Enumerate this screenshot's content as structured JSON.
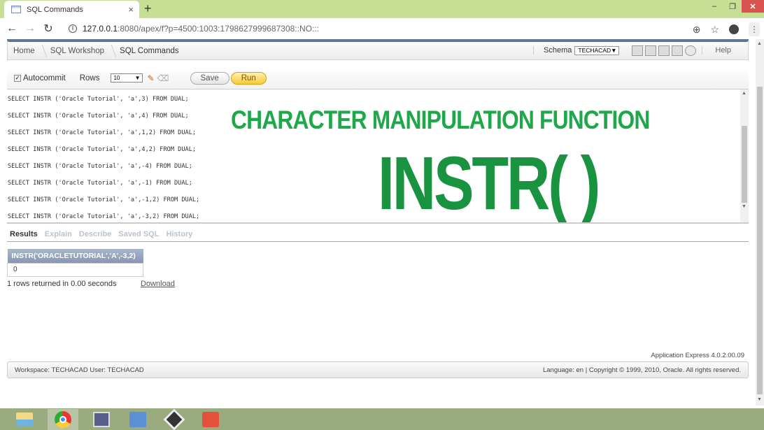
{
  "browser": {
    "tab_title": "SQL Commands",
    "new_tab_icon": "+",
    "close_tab_icon": "×",
    "url_host": "127.0.0.1",
    "url_rest": ":8080/apex/f?p=4500:1003:1798627999687308::NO:::",
    "window_controls": {
      "minimize": "–",
      "restore": "❐",
      "close": "✕"
    }
  },
  "breadcrumb": [
    "Home",
    "SQL Workshop",
    "SQL Commands"
  ],
  "schema": {
    "label": "Schema",
    "value": "TECHACAD"
  },
  "help_label": "Help",
  "toolbar": {
    "autocommit_label": "Autocommit",
    "autocommit_checked": true,
    "rows_label": "Rows",
    "rows_value": "10",
    "save_label": "Save",
    "run_label": "Run"
  },
  "sql_lines": [
    "SELECT INSTR ('Oracle Tutorial', 'a',3) FROM DUAL;",
    "SELECT INSTR ('Oracle Tutorial', 'a',4) FROM DUAL;",
    "SELECT INSTR ('Oracle Tutorial', 'a',1,2) FROM DUAL;",
    "SELECT INSTR ('Oracle Tutorial', 'a',4,2) FROM DUAL;",
    "SELECT INSTR ('Oracle Tutorial', 'a',-4) FROM DUAL;",
    "SELECT INSTR ('Oracle Tutorial', 'a',-1) FROM DUAL;",
    "SELECT INSTR ('Oracle Tutorial', 'a',-1,2) FROM DUAL;",
    "SELECT INSTR ('Oracle Tutorial', 'a',-3,2) FROM DUAL;"
  ],
  "overlay": {
    "title": "CHARACTER MANIPULATION FUNCTION",
    "function": "INSTR( )",
    "color": "#1fa84a"
  },
  "result_tabs": [
    {
      "label": "Results",
      "active": true
    },
    {
      "label": "Explain",
      "active": false
    },
    {
      "label": "Describe",
      "active": false
    },
    {
      "label": "Saved SQL",
      "active": false
    },
    {
      "label": "History",
      "active": false
    }
  ],
  "result": {
    "column": "INSTR('ORACLETUTORIAL','A',-3,2)",
    "rows": [
      "0"
    ],
    "status": "1 rows returned in 0.00 seconds",
    "download_label": "Download"
  },
  "footer": {
    "version": "Application Express 4.0.2.00.09",
    "workspace": "Workspace: TECHACAD User: TECHACAD",
    "copyright": "Language: en | Copyright © 1999, 2010, Oracle. All rights reserved."
  },
  "taskbar": [
    "file-explorer",
    "chrome",
    "virtual-machine",
    "search-app",
    "tool-app",
    "powerpoint"
  ]
}
